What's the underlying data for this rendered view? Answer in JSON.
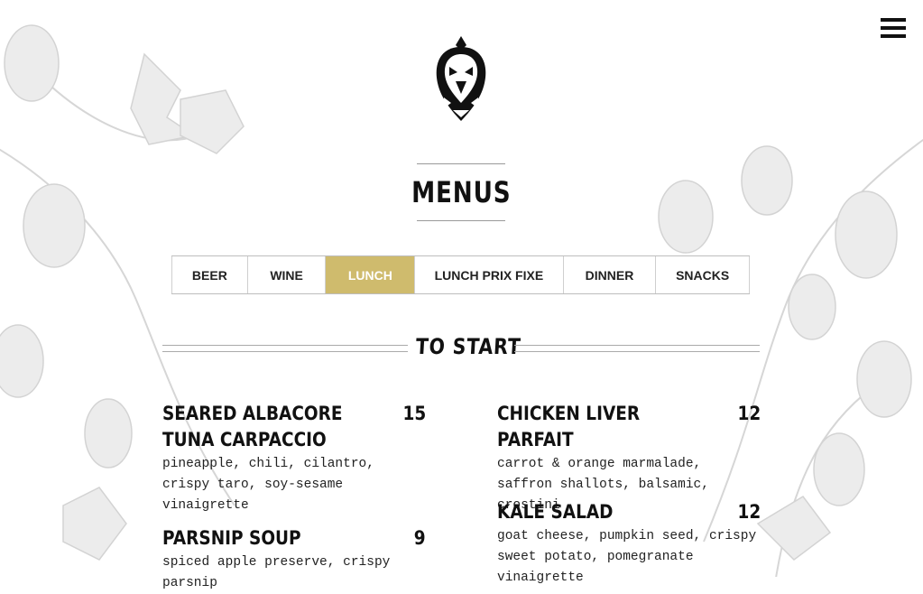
{
  "page": {
    "title": "MENUS"
  },
  "tabs": [
    {
      "label": "BEER",
      "active": false
    },
    {
      "label": "WINE",
      "active": false
    },
    {
      "label": "LUNCH",
      "active": true
    },
    {
      "label": "LUNCH PRIX FIXE",
      "active": false
    },
    {
      "label": "DINNER",
      "active": false
    },
    {
      "label": "SNACKS",
      "active": false
    }
  ],
  "section": {
    "heading": "TO START"
  },
  "items": [
    {
      "name": "SEARED ALBACORE TUNA CARPACCIO",
      "price": "15",
      "description": "pineapple, chili, cilantro, crispy taro, soy-sesame vinaigrette"
    },
    {
      "name": "CHICKEN LIVER PARFAIT",
      "price": "12",
      "description": "carrot & orange marmalade, saffron shallots, balsamic, crostini"
    },
    {
      "name": "PARSNIP SOUP",
      "price": "9",
      "description": "spiced apple preserve, crispy parsnip"
    },
    {
      "name": "KALE SALAD",
      "price": "12",
      "description": "goat cheese, pumpkin seed, crispy sweet potato, pomegranate vinaigrette"
    }
  ],
  "colors": {
    "accent": "#cfbb6d",
    "text": "#111111"
  },
  "icons": {
    "menu": "hamburger-menu-icon",
    "logo": "bison-hop-logo-icon"
  }
}
